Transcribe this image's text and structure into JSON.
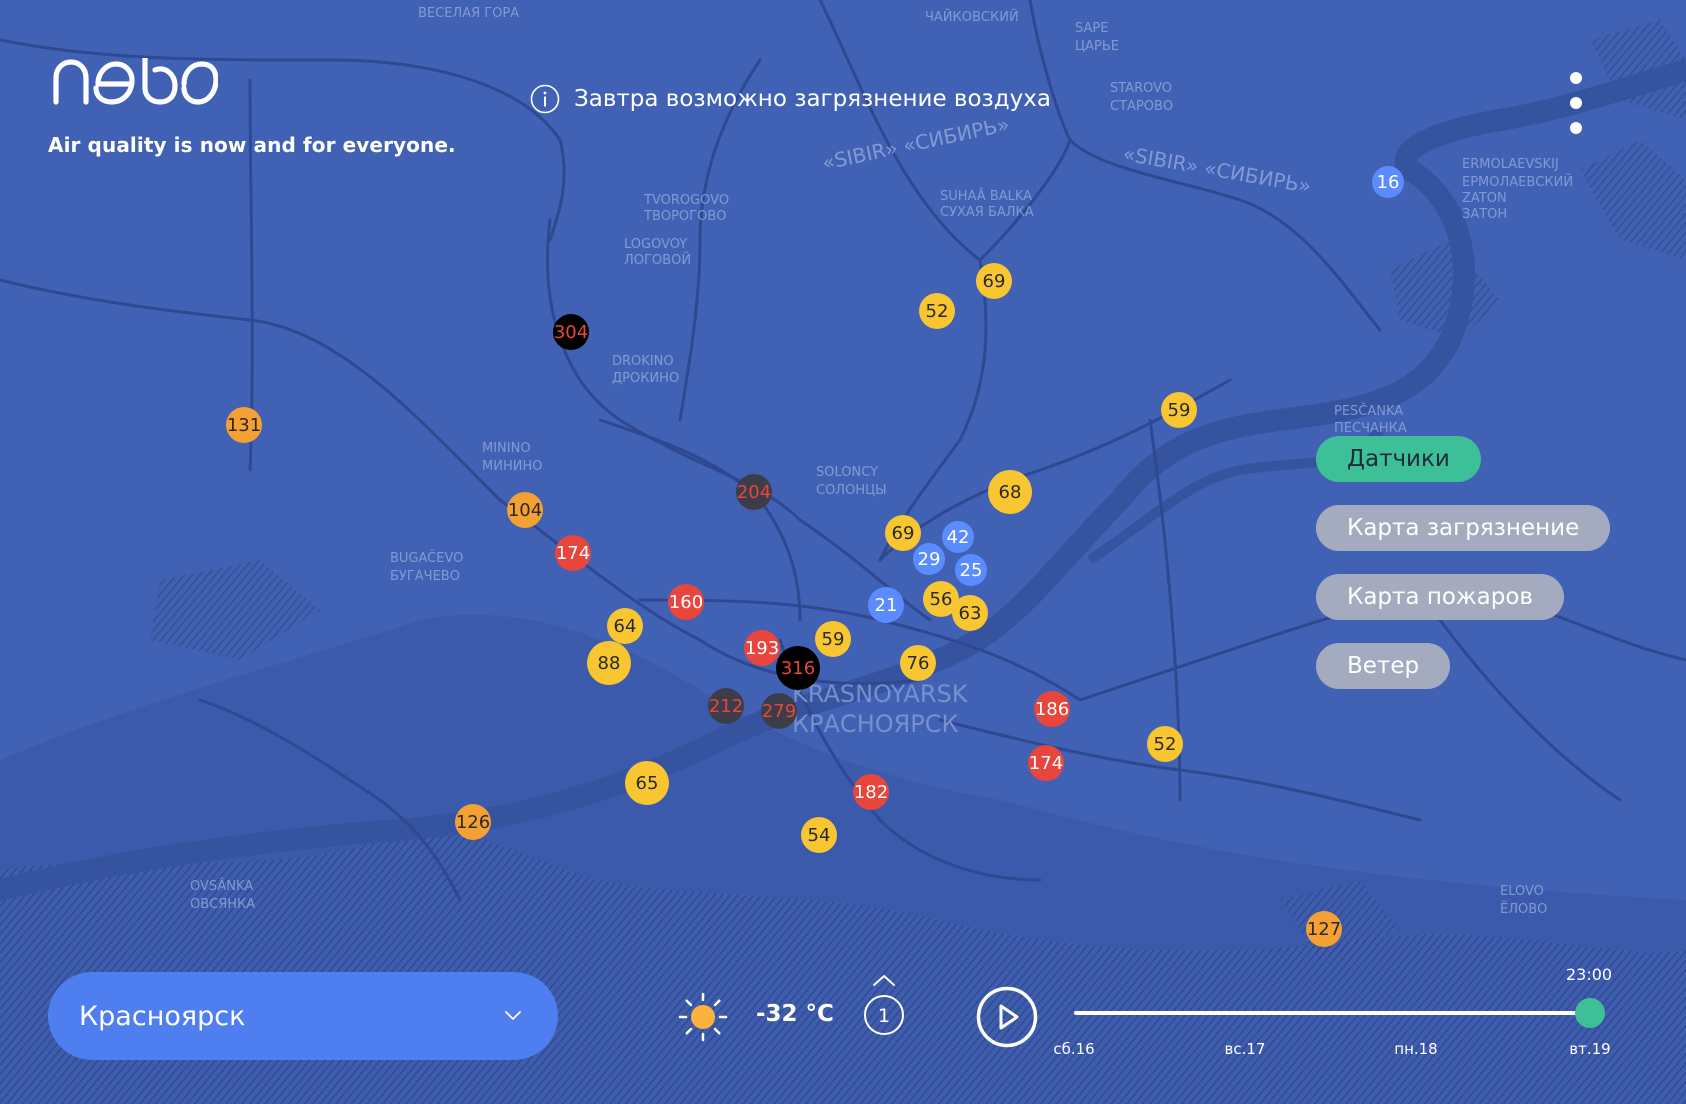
{
  "app": {
    "logo_text": "nebo",
    "tagline": "Air quality is now and for everyone.",
    "notice": "Завтра возможно загрязнение воздуха"
  },
  "layers": [
    {
      "label": "Датчики",
      "active": true
    },
    {
      "label": "Карта загрязнение",
      "active": false
    },
    {
      "label": "Карта пожаров",
      "active": false
    },
    {
      "label": "Ветер",
      "active": false
    }
  ],
  "city_selector": {
    "value": "Красноярск"
  },
  "weather": {
    "icon": "sun-icon",
    "temperature": "-32 °C"
  },
  "forecast_badge": {
    "value": "1"
  },
  "timeline": {
    "time": "23:00",
    "days": [
      "сб.16",
      "вс.17",
      "пн.18",
      "вт.19"
    ],
    "position": 1.0
  },
  "map_labels": [
    "ВЕСЕЛАЯ ГОРА",
    "ЧАЙКОВСКИЙ",
    "SAPE",
    "ЦАРЬЕ",
    "STAROVO",
    "СТАРОВО",
    "«SIBIR» «СИБИРЬ»",
    "«SIBIR» «СИБИРЬ»",
    "TVOROGOVO",
    "ТВОРОГОВО",
    "LOGOVOY",
    "ЛОГОВОЙ",
    "SUHAÂ BALKA",
    "СУХАЯ БАЛКА",
    "ERMOLAEVSKIJ",
    "ЕРМОЛАЕВСКИЙ",
    "ZATON",
    "ЗАТОН",
    "DROKINO",
    "ДРОКИНО",
    "MININO",
    "МИНИНО",
    "SOLONCY",
    "СОЛОНЦЫ",
    "PESČANKA",
    "ПЕСЧАНКА",
    "BUGAČEVO",
    "БУГАЧЕВО",
    "KRASNOYARSK",
    "КРАСНОЯРСК",
    "OVSÂNKA",
    "ОВСЯНКА",
    "ELOVO",
    "ЁЛОВО"
  ],
  "colors": {
    "good": "#5b8cff",
    "moderate": "#f8c630",
    "unhealthy_sensitive": "#f5a033",
    "unhealthy": "#e8453c",
    "very_unhealthy": "#3d3d4a",
    "hazardous": "#000000",
    "accent": "#3dbf98",
    "map": "#3f5fb0"
  },
  "sensors": [
    {
      "aqi": 16,
      "level": "good"
    },
    {
      "aqi": 69,
      "level": "moderate"
    },
    {
      "aqi": 52,
      "level": "moderate"
    },
    {
      "aqi": 304,
      "level": "hazardous"
    },
    {
      "aqi": 59,
      "level": "moderate"
    },
    {
      "aqi": 131,
      "level": "unhealthy_sensitive"
    },
    {
      "aqi": 68,
      "level": "moderate"
    },
    {
      "aqi": 204,
      "level": "very_unhealthy"
    },
    {
      "aqi": 104,
      "level": "unhealthy_sensitive"
    },
    {
      "aqi": 69,
      "level": "moderate"
    },
    {
      "aqi": 42,
      "level": "good"
    },
    {
      "aqi": 174,
      "level": "unhealthy"
    },
    {
      "aqi": 29,
      "level": "good"
    },
    {
      "aqi": 25,
      "level": "good"
    },
    {
      "aqi": 160,
      "level": "unhealthy"
    },
    {
      "aqi": 56,
      "level": "moderate"
    },
    {
      "aqi": 21,
      "level": "good"
    },
    {
      "aqi": 63,
      "level": "moderate"
    },
    {
      "aqi": 64,
      "level": "moderate"
    },
    {
      "aqi": 59,
      "level": "moderate"
    },
    {
      "aqi": 193,
      "level": "unhealthy"
    },
    {
      "aqi": 88,
      "level": "moderate"
    },
    {
      "aqi": 316,
      "level": "hazardous"
    },
    {
      "aqi": 76,
      "level": "moderate"
    },
    {
      "aqi": 212,
      "level": "very_unhealthy"
    },
    {
      "aqi": 279,
      "level": "very_unhealthy"
    },
    {
      "aqi": 186,
      "level": "unhealthy"
    },
    {
      "aqi": 52,
      "level": "moderate"
    },
    {
      "aqi": 174,
      "level": "unhealthy"
    },
    {
      "aqi": 65,
      "level": "moderate"
    },
    {
      "aqi": 182,
      "level": "unhealthy"
    },
    {
      "aqi": 126,
      "level": "unhealthy_sensitive"
    },
    {
      "aqi": 54,
      "level": "moderate"
    },
    {
      "aqi": 127,
      "level": "unhealthy_sensitive"
    }
  ]
}
